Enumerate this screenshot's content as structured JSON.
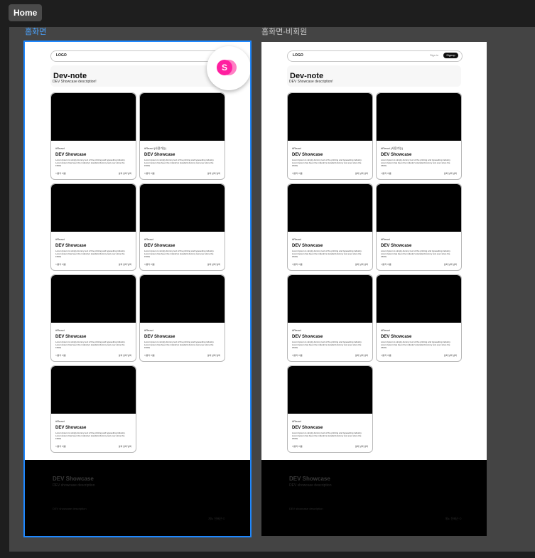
{
  "toolbar": {
    "tab_label": "Home"
  },
  "frames": [
    {
      "label": "홈화면",
      "selected": true,
      "logo": "LOGO",
      "auth_buttons_visible": false,
      "hero": {
        "title": "Dev-note",
        "description": "DEV Showcase description!"
      },
      "cards": [
        {
          "tag": "#React",
          "title": "DEV Showcase",
          "body": "Lorem Ipsum is simply dummy text of the printing and typesetting industry. Lorem Ipsum has been the industry's standard dummy text ever since the 1500s",
          "author": "사용자 이름",
          "date": "날짜 날짜 날짜"
        },
        {
          "tag": "#React (사용가능)",
          "title": "DEV Showcase",
          "body": "Lorem Ipsum is simply dummy text of the printing and typesetting industry. Lorem Ipsum has been the industry's standard dummy text ever since the 1500s",
          "author": "사용자 이름",
          "date": "날짜 날짜 날짜"
        },
        {
          "tag": "#React",
          "title": "DEV Showcase",
          "body": "Lorem Ipsum is simply dummy text of the printing and typesetting industry. Lorem Ipsum has been the industry's standard dummy text ever since the 1500s",
          "author": "사용자 이름",
          "date": "날짜 날짜 날짜"
        },
        {
          "tag": "#React",
          "title": "DEV Showcase",
          "body": "Lorem Ipsum is simply dummy text of the printing and typesetting industry. Lorem Ipsum has been the industry's standard dummy text ever since the 1500s",
          "author": "사용자 이름",
          "date": "날짜 날짜 날짜"
        },
        {
          "tag": "#React",
          "title": "DEV Showcase",
          "body": "Lorem Ipsum is simply dummy text of the printing and typesetting industry. Lorem Ipsum has been the industry's standard dummy text ever since the 1500s",
          "author": "사용자 이름",
          "date": "날짜 날짜 날짜"
        },
        {
          "tag": "#React",
          "title": "DEV Showcase",
          "body": "Lorem Ipsum is simply dummy text of the printing and typesetting industry. Lorem Ipsum has been the industry's standard dummy text ever since the 1500s",
          "author": "사용자 이름",
          "date": "날짜 날짜 날짜"
        },
        {
          "tag": "#React",
          "title": "DEV Showcase",
          "body": "Lorem Ipsum is simply dummy text of the printing and typesetting industry. Lorem Ipsum has been the industry's standard dummy text ever since the 1500s",
          "author": "사용자 이름",
          "date": "날짜 날짜 날짜"
        }
      ],
      "footer": {
        "title": "DEV Showcase",
        "subtitle": "DEV showcase description",
        "description": "DEV showcase description",
        "copyright": "개노 진혜근 ©"
      },
      "avatar": {
        "initial": "S",
        "color": "#ff1fa0"
      }
    },
    {
      "label": "홈화면-비회원",
      "selected": false,
      "logo": "LOGO",
      "auth_buttons_visible": true,
      "signin_label": "Sign in",
      "signup_label": "Signup",
      "hero": {
        "title": "Dev-note",
        "description": "DEV Showcase description!"
      },
      "cards": [
        {
          "tag": "#React",
          "title": "DEV Showcase",
          "body": "Lorem Ipsum is simply dummy text of the printing and typesetting industry. Lorem Ipsum has been the industry's standard dummy text ever since the 1500s",
          "author": "사용자 이름",
          "date": "날짜 날짜 날짜"
        },
        {
          "tag": "#React (사용가능)",
          "title": "DEV Showcase",
          "body": "Lorem Ipsum is simply dummy text of the printing and typesetting industry. Lorem Ipsum has been the industry's standard dummy text ever since the 1500s",
          "author": "사용자 이름",
          "date": "날짜 날짜 날짜"
        },
        {
          "tag": "#React",
          "title": "DEV Showcase",
          "body": "Lorem Ipsum is simply dummy text of the printing and typesetting industry. Lorem Ipsum has been the industry's standard dummy text ever since the 1500s",
          "author": "사용자 이름",
          "date": "날짜 날짜 날짜"
        },
        {
          "tag": "#React",
          "title": "DEV Showcase",
          "body": "Lorem Ipsum is simply dummy text of the printing and typesetting industry. Lorem Ipsum has been the industry's standard dummy text ever since the 1500s",
          "author": "사용자 이름",
          "date": "날짜 날짜 날짜"
        },
        {
          "tag": "#React",
          "title": "DEV Showcase",
          "body": "Lorem Ipsum is simply dummy text of the printing and typesetting industry. Lorem Ipsum has been the industry's standard dummy text ever since the 1500s",
          "author": "사용자 이름",
          "date": "날짜 날짜 날짜"
        },
        {
          "tag": "#React",
          "title": "DEV Showcase",
          "body": "Lorem Ipsum is simply dummy text of the printing and typesetting industry. Lorem Ipsum has been the industry's standard dummy text ever since the 1500s",
          "author": "사용자 이름",
          "date": "날짜 날짜 날짜"
        },
        {
          "tag": "#React",
          "title": "DEV Showcase",
          "body": "Lorem Ipsum is simply dummy text of the printing and typesetting industry. Lorem Ipsum has been the industry's standard dummy text ever since the 1500s",
          "author": "사용자 이름",
          "date": "날짜 날짜 날짜"
        }
      ],
      "footer": {
        "title": "DEV Showcase",
        "subtitle": "DEV showcase description",
        "description": "DEV showcase description",
        "copyright": "개노 진혜근 ©"
      }
    }
  ]
}
